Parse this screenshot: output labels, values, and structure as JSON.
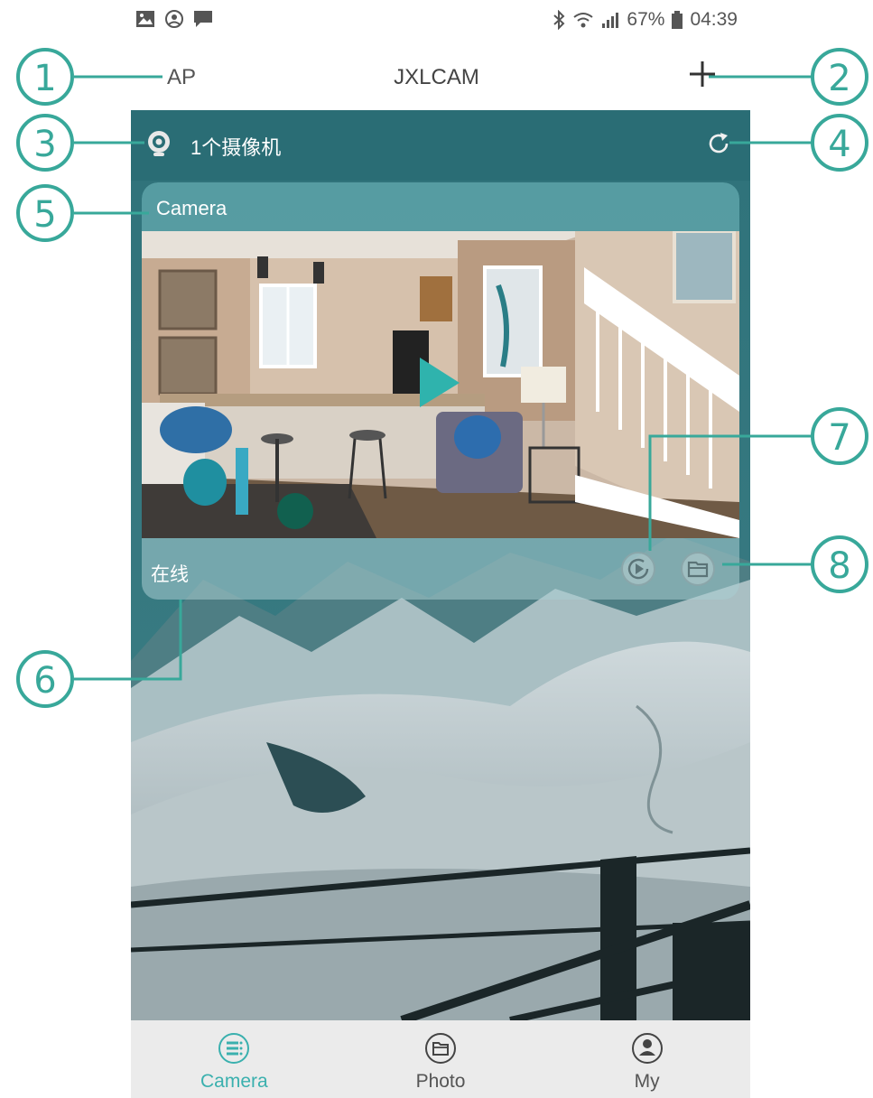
{
  "status_bar": {
    "left_icons": [
      "image-icon",
      "account-circle-icon",
      "message-icon"
    ],
    "battery_percent": "67%",
    "time": "04:39"
  },
  "header": {
    "left_label": "AP",
    "title": "JXLCAM",
    "add_icon": "plus-icon"
  },
  "camera_list": {
    "count_label": "1个摄像机",
    "refresh_icon": "refresh-icon"
  },
  "camera_card": {
    "name": "Camera",
    "status": "在线",
    "play_icon": "play-icon",
    "playback_icon": "playback-icon",
    "files_icon": "folder-icon"
  },
  "tabs": [
    {
      "label": "Camera",
      "icon": "list-icon",
      "active": true
    },
    {
      "label": "Photo",
      "icon": "folder-icon",
      "active": false
    },
    {
      "label": "My",
      "icon": "person-icon",
      "active": false
    }
  ],
  "callouts": [
    "1",
    "2",
    "3",
    "4",
    "5",
    "6",
    "7",
    "8"
  ],
  "colors": {
    "accent": "#3ab0ae",
    "panel": "#2a6d75",
    "callout": "#38a89a",
    "tabbar": "#ebebeb"
  }
}
